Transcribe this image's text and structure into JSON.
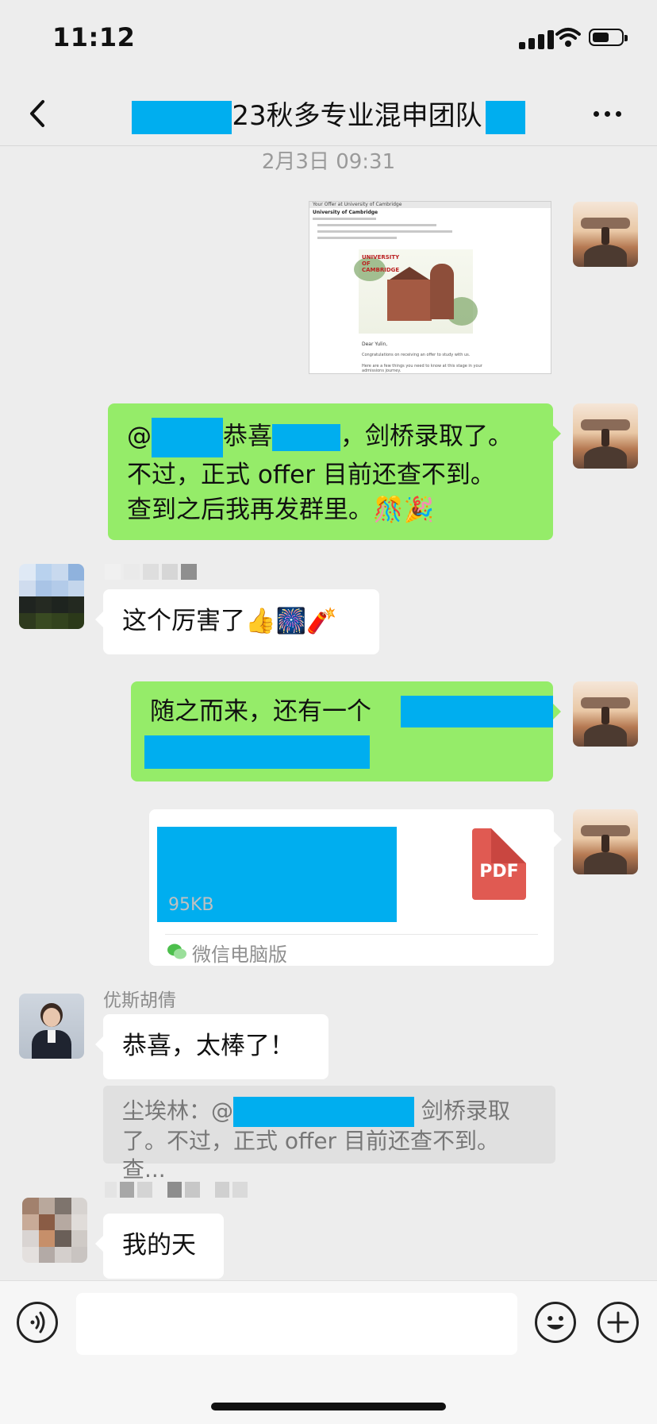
{
  "status_bar": {
    "time": "11:12"
  },
  "nav": {
    "title_visible": "23秋多专业混申团队"
  },
  "chat": {
    "timestamp": "2月3日 09:31",
    "msg1": {
      "type": "image",
      "email_subject": "Your Offer at University of Cambridge",
      "sender": "University of Cambridge",
      "logo_text": "UNIVERSITY OF CAMBRIDGE",
      "greeting": "Dear Yulin,",
      "body1": "Congratulations on receiving an offer to study with us.",
      "body2": "Here are a few things you need to know at this stage in your admissions journey."
    },
    "msg2": {
      "line1_prefix": "@",
      "line1_mid": "恭喜",
      "line1_suffix": "，剑桥录取了。",
      "line2": "不过，正式 offer 目前还查不到。",
      "line3": "查到之后我再发群里。",
      "emojis": "🎊🎉"
    },
    "msg3": {
      "text": "这个厉害了",
      "emojis": "👍🎆🧨"
    },
    "msg4": {
      "text_prefix": "随之而来，还有一个"
    },
    "msg5": {
      "file_size": "95KB",
      "file_type": "PDF",
      "source": "微信电脑版"
    },
    "msg6": {
      "sender": "优斯胡倩",
      "text": "恭喜，太棒了！",
      "quote_prefix": "尘埃林：@",
      "quote_suffix": " 剑桥录取",
      "quote_line2": "了。不过，正式 offer 目前还查不到。查..."
    },
    "msg7": {
      "text": "我的天"
    }
  },
  "colors": {
    "green_bubble": "#95ec69",
    "redaction": "#00aeef",
    "background": "#ededed"
  }
}
